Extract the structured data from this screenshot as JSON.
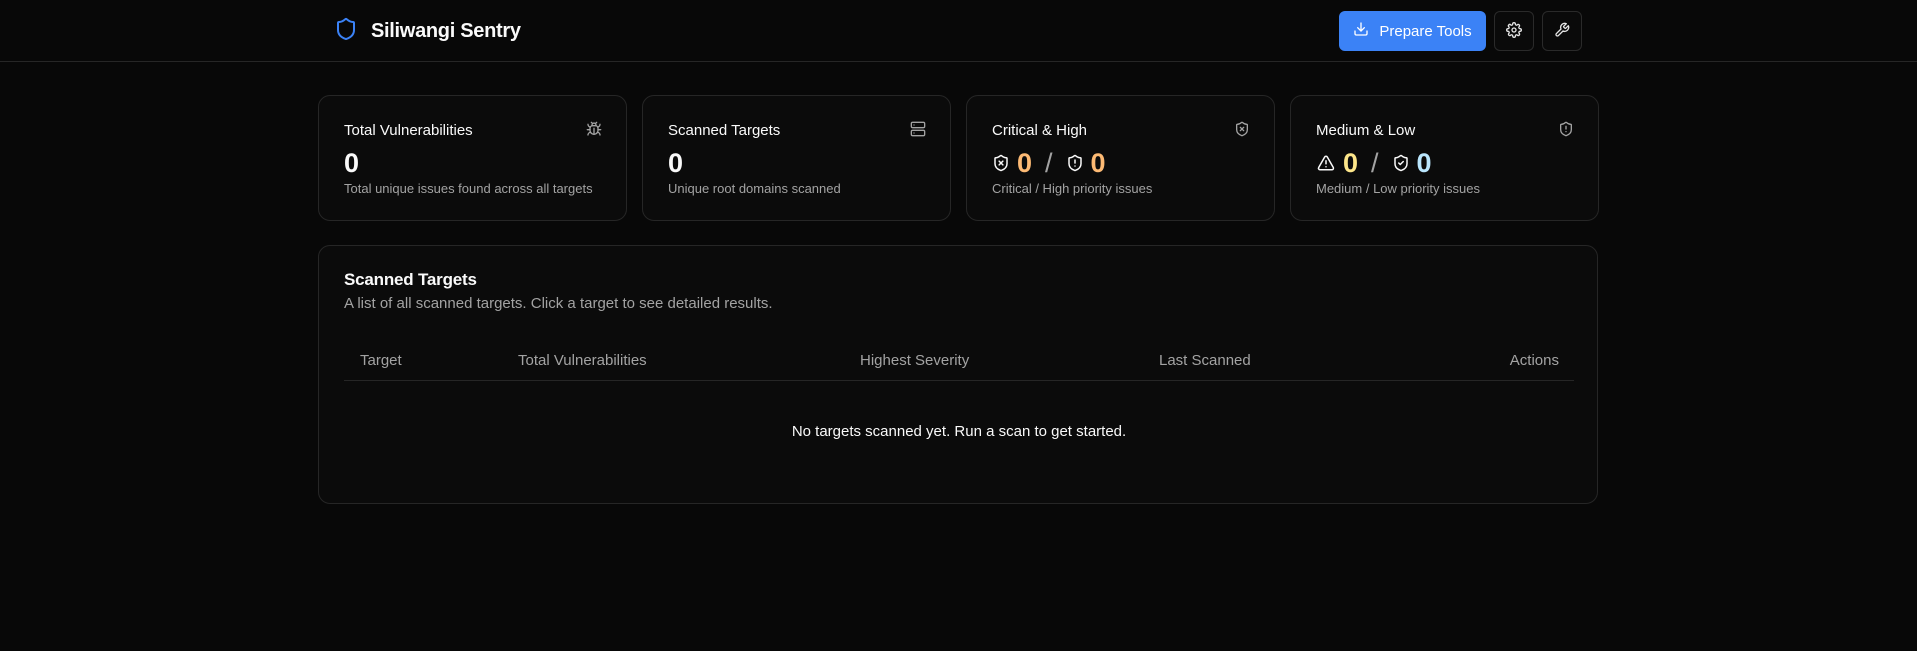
{
  "app": {
    "title": "Siliwangi Sentry"
  },
  "header": {
    "prepare_label": "Prepare Tools"
  },
  "stats": [
    {
      "title": "Total Vulnerabilities",
      "icon": "bug-icon",
      "value": "0",
      "desc": "Total unique issues found across all targets"
    },
    {
      "title": "Scanned Targets",
      "icon": "server-icon",
      "value": "0",
      "desc": "Unique root domains scanned"
    },
    {
      "title": "Critical & High",
      "icon": "shield-x-icon",
      "critical": "0",
      "separator": "/",
      "high": "0",
      "desc": "Critical / High priority issues"
    },
    {
      "title": "Medium & Low",
      "icon": "shield-alert-icon",
      "medium": "0",
      "separator": "/",
      "low": "0",
      "desc": "Medium / Low priority issues"
    }
  ],
  "targets": {
    "title": "Scanned Targets",
    "subtitle": "A list of all scanned targets. Click a target to see detailed results.",
    "columns": [
      "Target",
      "Total Vulnerabilities",
      "Highest Severity",
      "Last Scanned",
      "Actions"
    ],
    "empty": "No targets scanned yet. Run a scan to get started."
  },
  "colors": {
    "accent": "#3b82f6",
    "critical": "#fdba74",
    "medium": "#fde68a",
    "low": "#bae6fd"
  }
}
